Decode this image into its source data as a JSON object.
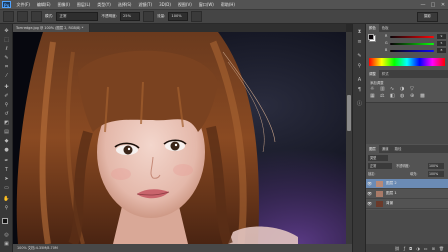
{
  "app": {
    "logo": "Ps"
  },
  "menu": [
    "文件(F)",
    "编辑(E)",
    "图像(I)",
    "图层(L)",
    "类型(Y)",
    "选择(S)",
    "滤镜(T)",
    "3D(D)",
    "视图(V)",
    "窗口(W)",
    "帮助(H)"
  ],
  "window_controls": {
    "minimize": "—",
    "maximize": "□",
    "close": "✕"
  },
  "options": {
    "mode_label": "模式:",
    "mode_value": "正常",
    "opacity_label": "不透明度:",
    "opacity_value": "25%",
    "flow_label": "流量:",
    "flow_value": "100%",
    "workspace": "摄影"
  },
  "document": {
    "tab_title": "Tom·edge.jpg @ 100% (图层 2, RGB/8) *",
    "status_text": "100%   文档:4.35M/8.70M"
  },
  "color_panel": {
    "tabs": [
      "颜色",
      "色板"
    ],
    "channels": [
      {
        "label": "R",
        "value": "9"
      },
      {
        "label": "G",
        "value": "5"
      },
      {
        "label": "B",
        "value": "8"
      }
    ]
  },
  "adjust_panel": {
    "tabs": [
      "调整",
      "样式"
    ],
    "add_label": "添加调整"
  },
  "layers_panel": {
    "tabs": [
      "图层",
      "通道",
      "路径"
    ],
    "kind_label": "类型",
    "blend_mode": "正常",
    "opacity_label": "不透明度:",
    "opacity_value": "100%",
    "lock_label": "锁定:",
    "fill_label": "填充:",
    "fill_value": "100%",
    "layers": [
      {
        "name": "图层 2",
        "selected": true
      },
      {
        "name": "图层 1",
        "selected": false
      },
      {
        "name": "背景",
        "selected": false
      }
    ]
  },
  "colors": {
    "accent_selection": "#6b8bb5",
    "panel_bg": "#535353",
    "menubar_bg": "#535353"
  }
}
